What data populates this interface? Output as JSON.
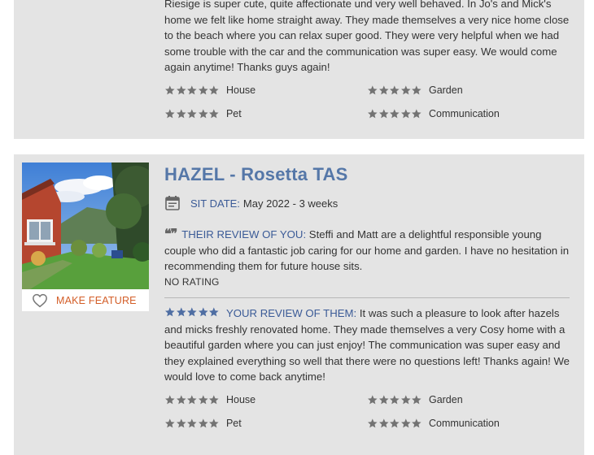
{
  "colors": {
    "card_bg": "#e4e4e4",
    "title_blue": "#5577a8",
    "label_blue": "#3b5b97",
    "star_grey": "#737373",
    "star_blue": "#4f6ea3",
    "feature_orange": "#d35d27"
  },
  "previous_card": {
    "review_text": "Riesige is super cute, quite affectionate und very well behaved. In Jo's and Mick's home we felt like home straight away. They made themselves a very nice home close to the beach where you can relax super good. They were very helpful when we had some trouble with the car and the communication was super easy. We would come again anytime! Thanks guys again!",
    "ratings": [
      {
        "label": "House",
        "stars": 5
      },
      {
        "label": "Garden",
        "stars": 5
      },
      {
        "label": "Pet",
        "stars": 5
      },
      {
        "label": "Communication",
        "stars": 5
      }
    ]
  },
  "current_card": {
    "title": "HAZEL - Rosetta TAS",
    "feature_label": "MAKE FEATURE",
    "sit_date_label": "SIT DATE:",
    "sit_date_value": "May 2022 - 3 weeks",
    "their_review_label": "THEIR REVIEW OF YOU:",
    "their_review_text": "Steffi and Matt are a delightful responsible young couple who did a fantastic job caring for our home and garden. I have no hesitation in recommending them for future house sits.",
    "no_rating": "NO RATING",
    "your_review_stars": 5,
    "your_review_label": "YOUR REVIEW OF THEM:",
    "your_review_text": "It was such a pleasure to look after hazels and micks freshly renovated home. They made themselves a very Cosy home with a beautiful garden where you can just enjoy! The communication was super easy and they explained everything so well that there were no questions left! Thanks again! We would love to come back anytime!",
    "ratings": [
      {
        "label": "House",
        "stars": 5
      },
      {
        "label": "Garden",
        "stars": 5
      },
      {
        "label": "Pet",
        "stars": 5
      },
      {
        "label": "Communication",
        "stars": 5
      }
    ]
  }
}
